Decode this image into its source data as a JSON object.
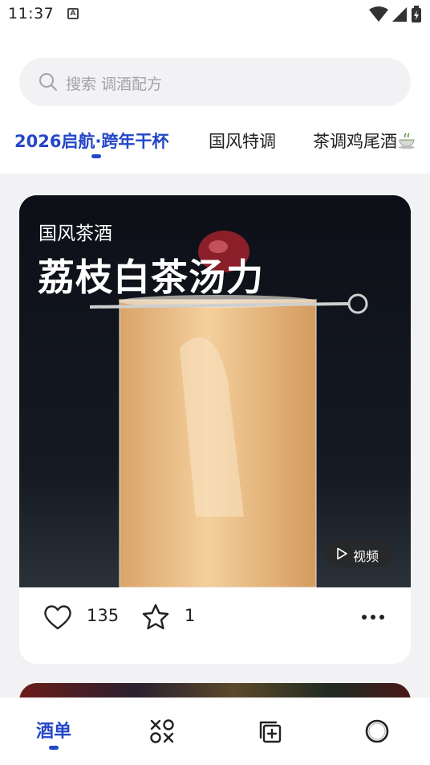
{
  "status_bar": {
    "time": "11:37",
    "notification_badge": "A"
  },
  "search": {
    "placeholder": "搜索 调酒配方"
  },
  "tabs": [
    {
      "label": "2026启航·跨年干杯",
      "active": true
    },
    {
      "label": "国风特调",
      "active": false
    },
    {
      "label": "茶调鸡尾酒",
      "active": false,
      "icon": "tea-cup-icon"
    }
  ],
  "card": {
    "category": "国风茶酒",
    "title": "荔枝白茶汤力",
    "video_label": "视频",
    "likes": "135",
    "favorites": "1"
  },
  "bottom_nav": [
    {
      "label": "酒单",
      "active": true
    },
    {
      "icon": "shapes-icon",
      "active": false
    },
    {
      "icon": "add-layer-icon",
      "active": false
    },
    {
      "icon": "profile-circle-icon",
      "active": false
    }
  ],
  "colors": {
    "accent": "#2347c9",
    "background": "#f2f2f4",
    "card": "#ffffff"
  }
}
